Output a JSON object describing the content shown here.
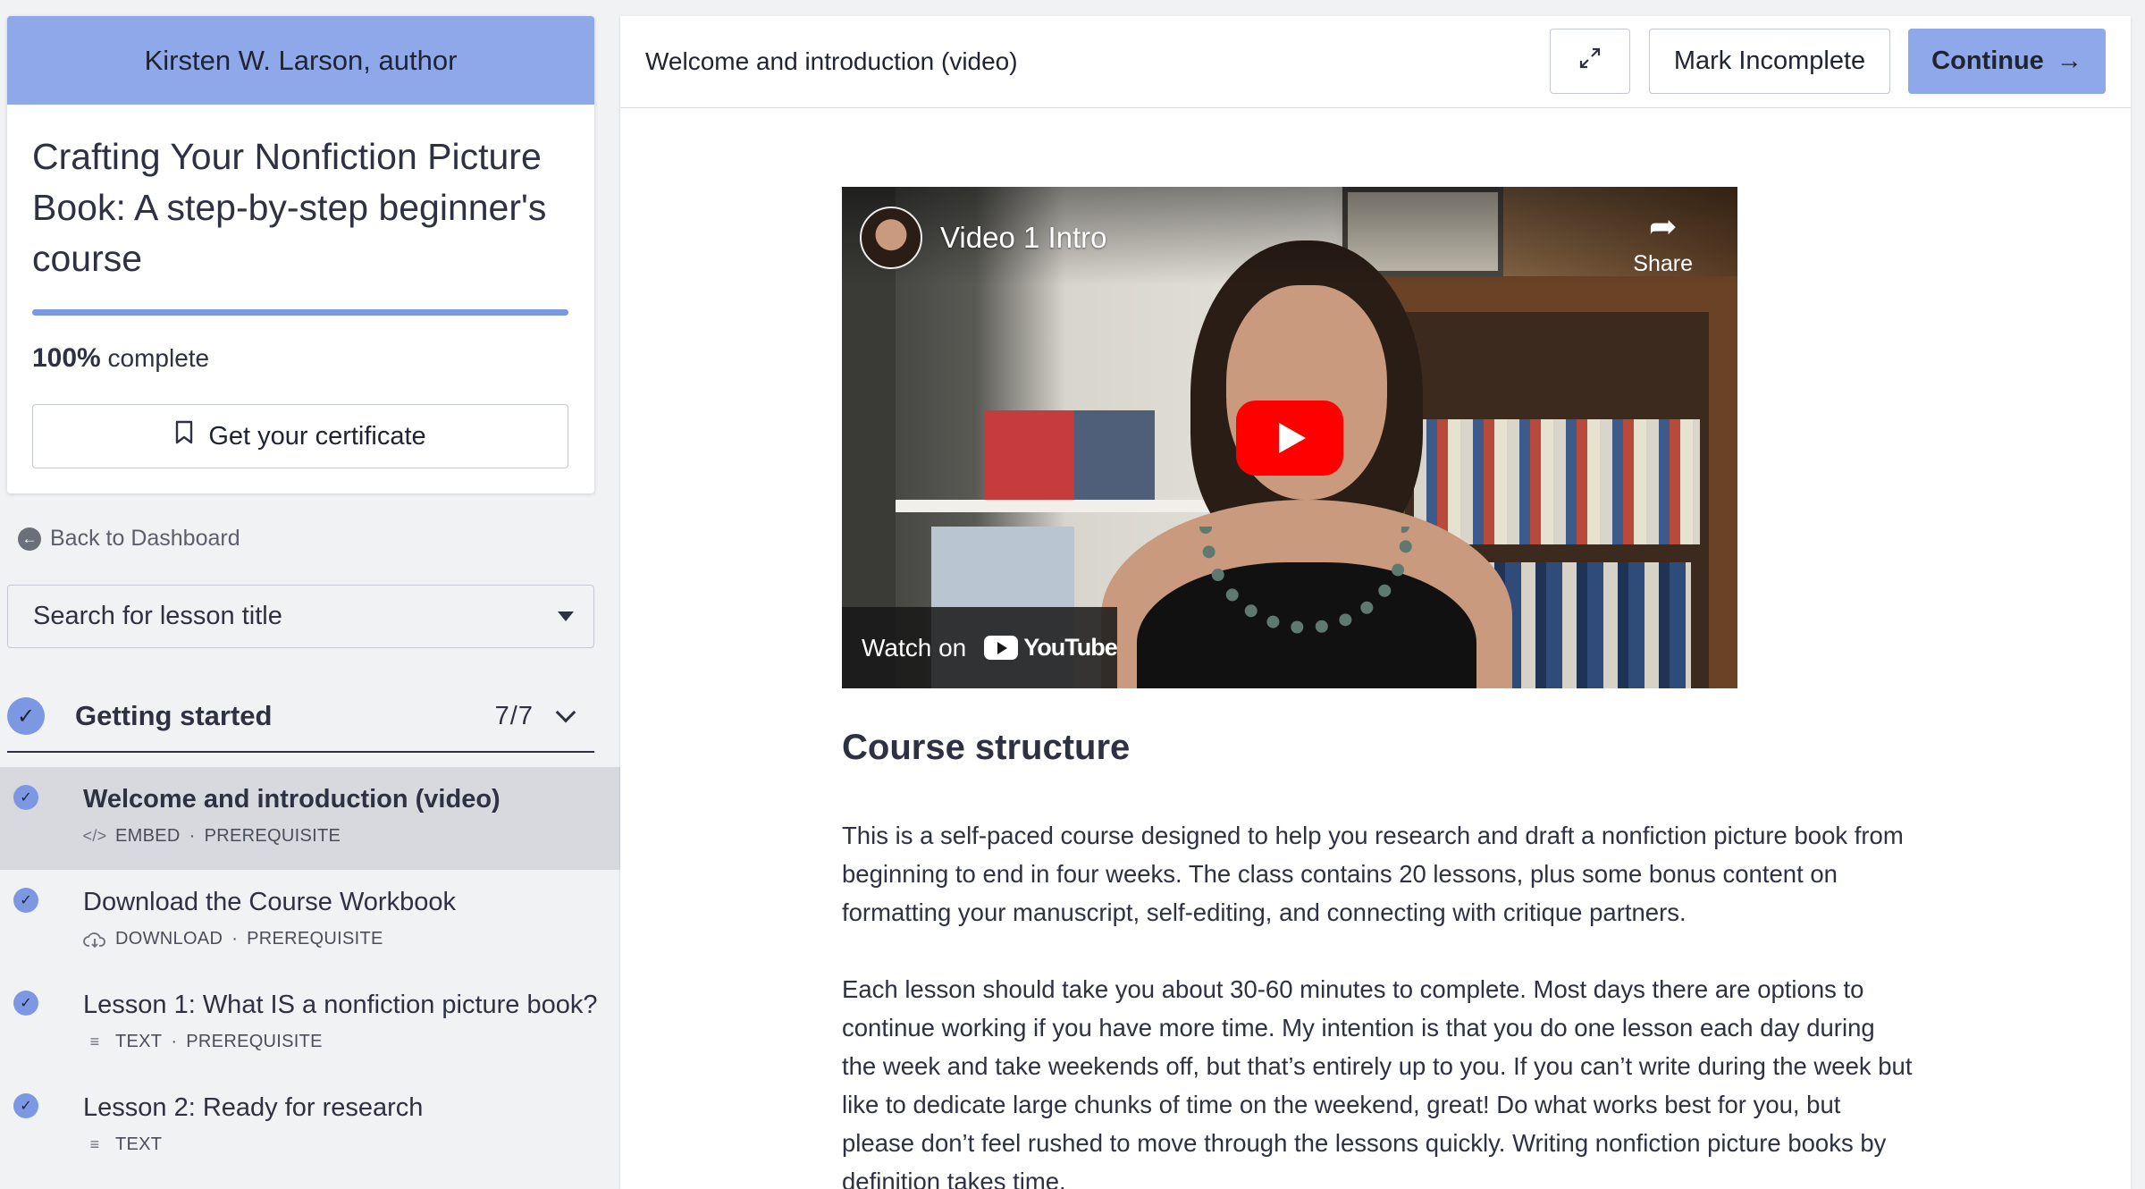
{
  "sidebar": {
    "author": "Kirsten W. Larson, author",
    "course_title": "Crafting Your Nonfiction Picture Book: A step-by-step beginner's course",
    "progress_percent": 100,
    "progress_value": "100%",
    "progress_suffix": "complete",
    "certificate_label": "Get your certificate",
    "back_label": "Back to Dashboard",
    "search_placeholder": "Search for lesson title",
    "section": {
      "title": "Getting started",
      "count": "7/7"
    },
    "lessons": [
      {
        "title": "Welcome and introduction (video)",
        "type": "EMBED",
        "tag": "PREREQUISITE",
        "icon": "code-icon",
        "active": true
      },
      {
        "title": "Download the Course Workbook",
        "type": "DOWNLOAD",
        "tag": "PREREQUISITE",
        "icon": "cloud-download-icon",
        "active": false
      },
      {
        "title": "Lesson 1: What IS a nonfiction picture book?",
        "type": "TEXT",
        "tag": "PREREQUISITE",
        "icon": "text-lines-icon",
        "active": false
      },
      {
        "title": "Lesson 2: Ready for research",
        "type": "TEXT",
        "tag": "",
        "icon": "text-lines-icon",
        "active": false
      }
    ]
  },
  "main": {
    "lesson_heading": "Welcome and introduction (video)",
    "mark_label": "Mark Incomplete",
    "continue_label": "Continue",
    "video": {
      "title": "Video 1 Intro",
      "share_label": "Share",
      "watch_on": "Watch on",
      "youtube": "YouTube"
    },
    "article": {
      "heading": "Course structure",
      "p1": "This is a self-paced course designed to help you research and draft a nonfiction picture book from beginning to end in four weeks. The class contains 20 lessons, plus some bonus content on formatting your manuscript, self-editing, and connecting with critique partners.",
      "p2": "Each lesson should take you about 30-60 minutes to complete. Most days there are options to continue working if you have more time. My intention is that you do one lesson each day during the week and take weekends off, but that’s entirely up to you. If you can’t write during the week but like to dedicate large chunks of time on the weekend, great! Do what works best for you, but please don’t feel rushed to move through the lessons quickly. Writing nonfiction picture books by definition takes time."
    }
  },
  "colors": {
    "accent": "#8fa8ea",
    "accent_dark": "#7d98e3",
    "youtube_red": "#ff0000"
  }
}
